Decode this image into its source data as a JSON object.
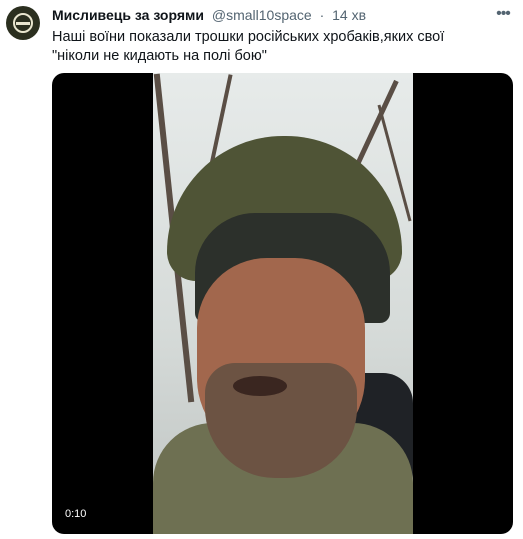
{
  "tweet": {
    "display_name": "Мисливець за зорями",
    "handle": "@small10space",
    "separator": "·",
    "time": "14 хв",
    "more_icon": "more-dots-icon",
    "text": "Наші воїни показали трошки російських хробаків,яких свої \"ніколи не кидають на полі бою\""
  },
  "media": {
    "duration": "0:10"
  }
}
